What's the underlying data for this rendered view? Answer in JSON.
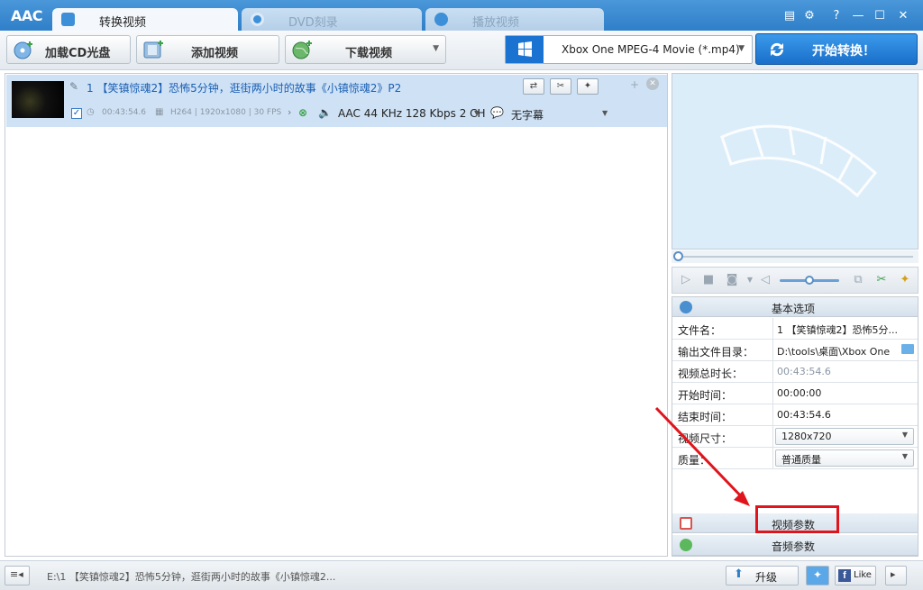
{
  "app": {
    "logo": "AAC"
  },
  "tabs": [
    {
      "label": "转换视频",
      "icon": "convert-video-icon",
      "active": true
    },
    {
      "label": "DVD刻录",
      "icon": "dvd-burn-icon",
      "active": false
    },
    {
      "label": "播放视频",
      "icon": "play-video-icon",
      "active": false
    }
  ],
  "toolbar": {
    "load_cd_label": "加载CD光盘",
    "add_video_label": "添加视频",
    "download_video_label": "下载视频",
    "profile_label": "Xbox One MPEG-4 Movie (*.mp4)",
    "convert_label": "开始转换！"
  },
  "file": {
    "index": "1",
    "title": "【笑镇惊魂2】恐怖5分钟，逛街两小时的故事《小镇惊魂2》P2",
    "duration": "00:43:54.6",
    "video_info": "H264 | 1920x1080 | 30 FPS",
    "audio_info": "AAC 44 KHz 128 Kbps 2 CH",
    "subtitle": "无字幕"
  },
  "props": {
    "basic_section": "基本选项",
    "rows": [
      {
        "key": "文件名：",
        "value": "1 【笑镇惊魂2】恐怖5分..."
      },
      {
        "key": "输出文件目录：",
        "value": "D:\\tools\\桌面\\Xbox One"
      },
      {
        "key": "视频总时长：",
        "value": "00:43:54.6"
      },
      {
        "key": "开始时间：",
        "value": "00:00:00"
      },
      {
        "key": "结束时间：",
        "value": "00:43:54.6"
      },
      {
        "key": "视频尺寸：",
        "value": "1280x720"
      },
      {
        "key": "质量：",
        "value": "普通质量"
      }
    ],
    "video_params": "视频参数",
    "audio_params": "音频参数"
  },
  "status": {
    "path": "E:\\1 【笑镇惊魂2】恐怖5分钟，逛街两小时的故事《小镇惊魂2...",
    "upgrade_label": "升级",
    "like_label": "Like"
  },
  "colors": {
    "accent": "#2f7fc9",
    "highlight": "#e0141c",
    "row_selected": "#cfe2f5"
  }
}
